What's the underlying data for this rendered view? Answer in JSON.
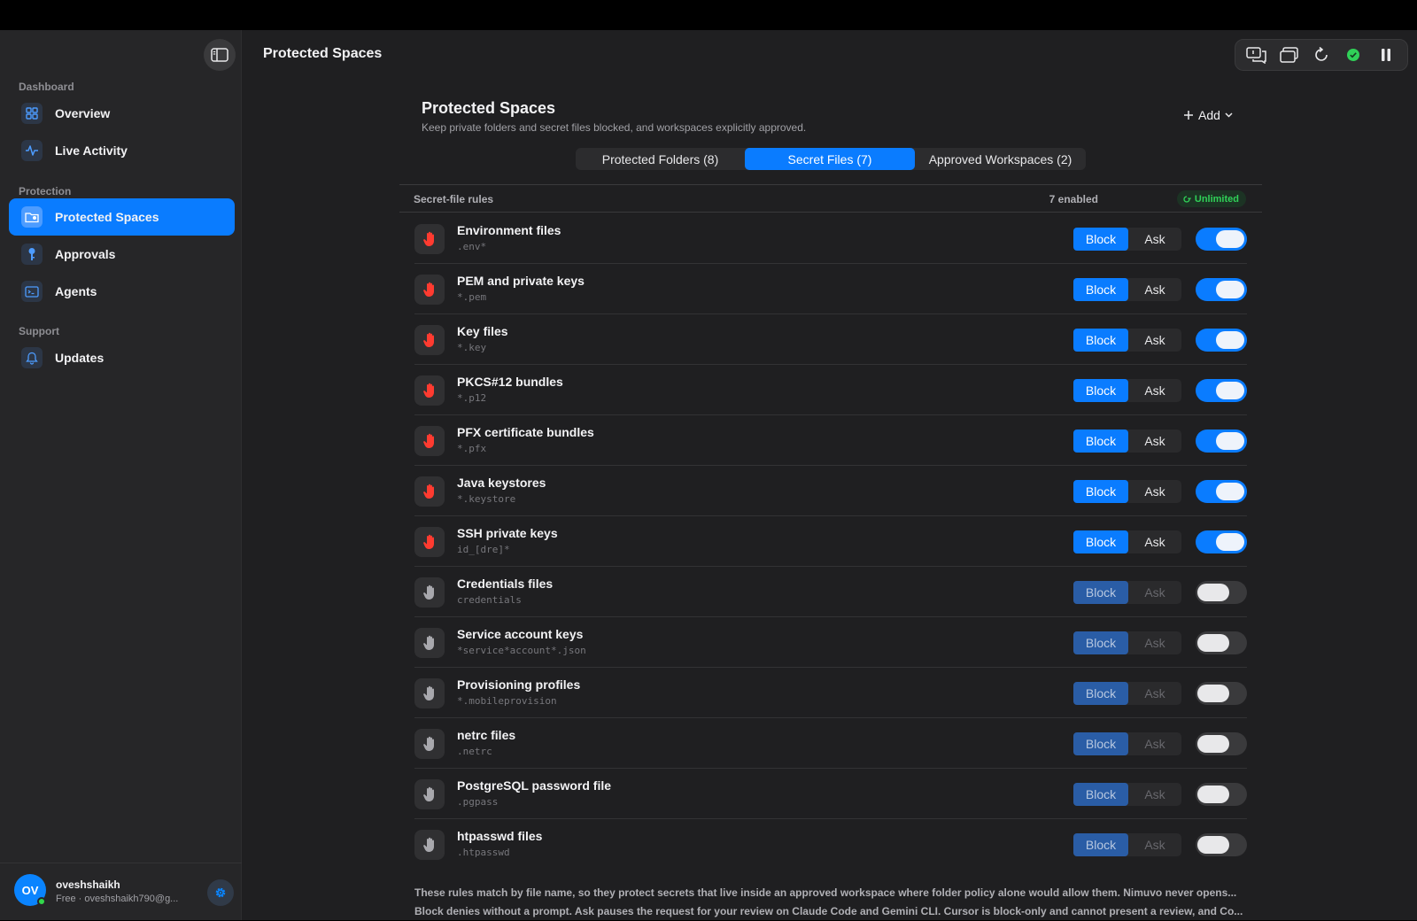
{
  "window": {
    "title": "Protected Spaces"
  },
  "sidebar": {
    "sections": [
      {
        "label": "Dashboard"
      },
      {
        "label": "Protection"
      },
      {
        "label": "Support"
      }
    ],
    "items": [
      {
        "label": "Overview",
        "icon": "grid-icon"
      },
      {
        "label": "Live Activity",
        "icon": "pulse-icon"
      },
      {
        "label": "Protected Spaces",
        "icon": "folder-shield-icon",
        "active": true
      },
      {
        "label": "Approvals",
        "icon": "key-icon"
      },
      {
        "label": "Agents",
        "icon": "terminal-icon"
      },
      {
        "label": "Updates",
        "icon": "bell-icon"
      }
    ],
    "user": {
      "initials": "OV",
      "name": "oveshshaikh",
      "plan": "Free · oveshshaikh790@g..."
    }
  },
  "main": {
    "title": "Protected Spaces",
    "subtitle": "Keep private folders and secret files blocked, and workspaces explicitly approved.",
    "add_label": "Add",
    "tabs": [
      {
        "label": "Protected Folders (8)"
      },
      {
        "label": "Secret Files (7)",
        "active": true
      },
      {
        "label": "Approved Workspaces (2)"
      }
    ],
    "rules_header": {
      "label": "Secret-file rules",
      "count": "7 enabled",
      "badge": "Unlimited"
    },
    "block_label": "Block",
    "ask_label": "Ask",
    "rules": [
      {
        "name": "Environment files",
        "pattern": ".env*",
        "enabled": true
      },
      {
        "name": "PEM and private keys",
        "pattern": "*.pem",
        "enabled": true
      },
      {
        "name": "Key files",
        "pattern": "*.key",
        "enabled": true
      },
      {
        "name": "PKCS#12 bundles",
        "pattern": "*.p12",
        "enabled": true
      },
      {
        "name": "PFX certificate bundles",
        "pattern": "*.pfx",
        "enabled": true
      },
      {
        "name": "Java keystores",
        "pattern": "*.keystore",
        "enabled": true
      },
      {
        "name": "SSH private keys",
        "pattern": "id_[dre]*",
        "enabled": true
      },
      {
        "name": "Credentials files",
        "pattern": "credentials",
        "enabled": false
      },
      {
        "name": "Service account keys",
        "pattern": "*service*account*.json",
        "enabled": false
      },
      {
        "name": "Provisioning profiles",
        "pattern": "*.mobileprovision",
        "enabled": false
      },
      {
        "name": "netrc files",
        "pattern": ".netrc",
        "enabled": false
      },
      {
        "name": "PostgreSQL password file",
        "pattern": ".pgpass",
        "enabled": false
      },
      {
        "name": "htpasswd files",
        "pattern": ".htpasswd",
        "enabled": false
      }
    ],
    "footnote": [
      "These rules match by file name, so they protect secrets that live inside an approved workspace where folder policy alone would allow them. Nimuvo never opens...",
      "Block denies without a prompt. Ask pauses the request for your review on Claude Code and Gemini CLI. Cursor is block-only and cannot present a review, and Co..."
    ]
  },
  "colors": {
    "accent": "#0a7cff",
    "danger": "#ff3b30",
    "success": "#30d158"
  }
}
